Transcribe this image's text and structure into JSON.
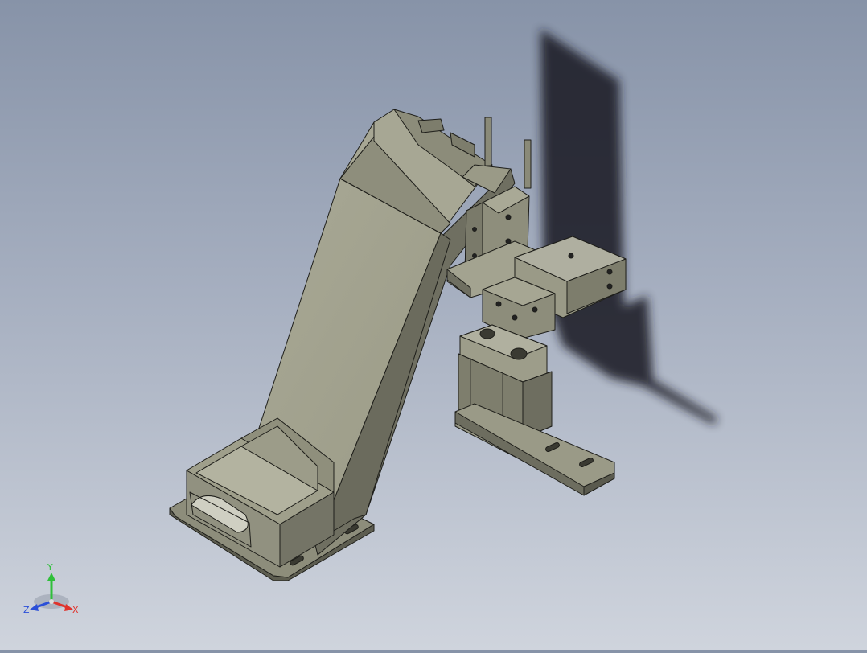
{
  "viewport": {
    "colors": {
      "background_top": "#8793a8",
      "background_bottom": "#cfd4dd",
      "part_face_light": "#a3a38e",
      "part_face_mid": "#8b8b79",
      "part_face_dark": "#6f6f61",
      "edge": "#1e1e1a",
      "shadow": "#1c1f26"
    }
  },
  "triad": {
    "x_label": "X",
    "y_label": "Y",
    "z_label": "Z",
    "x_color": "#e0332c",
    "y_color": "#2fbf3a",
    "z_color": "#2b4fd8"
  }
}
